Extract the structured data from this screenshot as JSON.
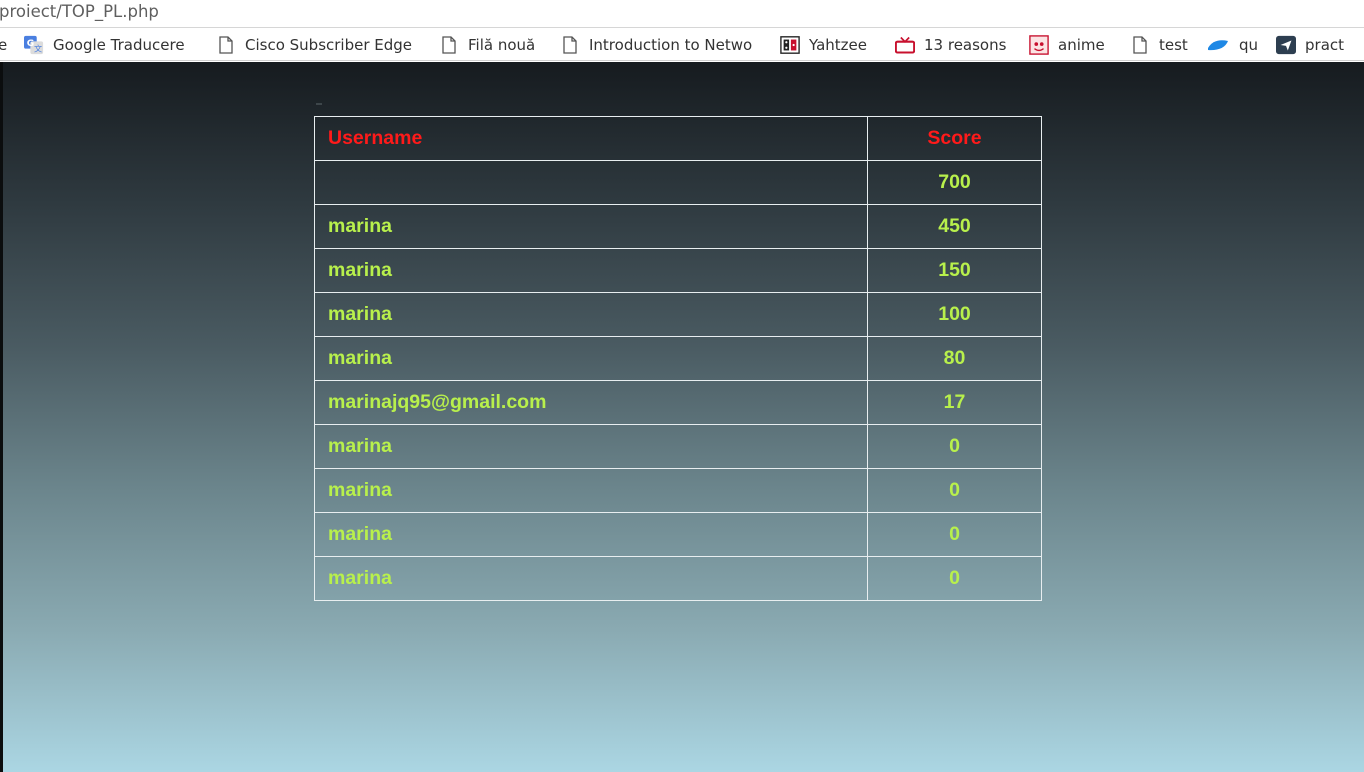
{
  "browser": {
    "url": "proiect/TOP_PL.php",
    "bookmarks": [
      {
        "label": "e",
        "icon": "folder-icon"
      },
      {
        "label": "Google Traducere",
        "icon": "google-translate-icon"
      },
      {
        "label": "Cisco Subscriber Edge",
        "icon": "page-icon"
      },
      {
        "label": "Filă nouă",
        "icon": "page-icon"
      },
      {
        "label": "Introduction to Netwo",
        "icon": "page-icon"
      },
      {
        "label": "Yahtzee",
        "icon": "yahtzee-icon"
      },
      {
        "label": "13 reasons",
        "icon": "tv-icon"
      },
      {
        "label": "anime",
        "icon": "anime-icon"
      },
      {
        "label": "test",
        "icon": "page-icon"
      },
      {
        "label": "qu",
        "icon": "qu-icon"
      },
      {
        "label": "pract",
        "icon": "send-icon"
      }
    ]
  },
  "leaderboard": {
    "headers": {
      "username": "Username",
      "score": "Score"
    },
    "rows": [
      {
        "username": "",
        "score": "700"
      },
      {
        "username": "marina",
        "score": "450"
      },
      {
        "username": "marina",
        "score": "150"
      },
      {
        "username": "marina",
        "score": "100"
      },
      {
        "username": "marina",
        "score": "80"
      },
      {
        "username": "marinajq95@gmail.com",
        "score": "17"
      },
      {
        "username": "marina",
        "score": "0"
      },
      {
        "username": "marina",
        "score": "0"
      },
      {
        "username": "marina",
        "score": "0"
      },
      {
        "username": "marina",
        "score": "0"
      }
    ]
  },
  "colors": {
    "header_text": "#ff1a1a",
    "cell_text": "#b8f04c",
    "border": "#e8eef0"
  }
}
